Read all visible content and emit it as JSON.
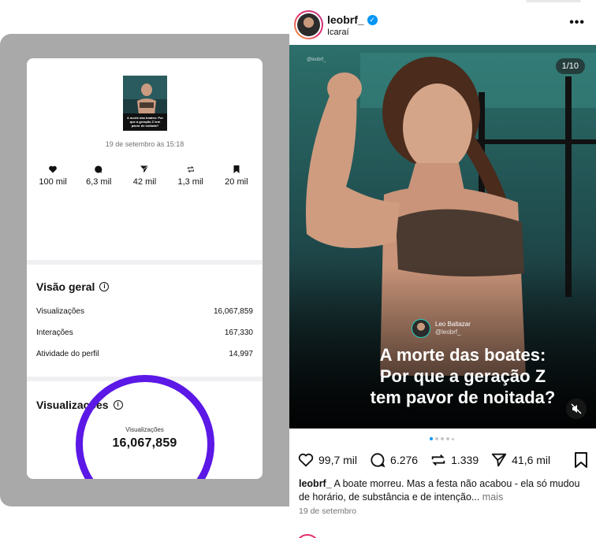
{
  "insights": {
    "post_date": "19 de setembro às 15:18",
    "thumbnail_text": "A morte das boates: Por que a geração Z tem pavor de noitada?",
    "stats": [
      {
        "icon": "heart-icon",
        "value": "100 mil"
      },
      {
        "icon": "comment-icon",
        "value": "6,3 mil"
      },
      {
        "icon": "send-icon",
        "value": "42 mil"
      },
      {
        "icon": "repost-icon",
        "value": "1,3 mil"
      },
      {
        "icon": "bookmark-icon",
        "value": "20 mil"
      }
    ],
    "overview": {
      "title": "Visão geral",
      "rows": [
        {
          "label": "Visualizações",
          "value": "16,067,859"
        },
        {
          "label": "Interações",
          "value": "167,330"
        },
        {
          "label": "Atividade do perfil",
          "value": "14,997"
        }
      ]
    },
    "views": {
      "title": "Visualizações",
      "donut_label": "Visualizações",
      "donut_value": "16,067,859",
      "accent": "#5b18e6"
    }
  },
  "post": {
    "username": "leobrf_",
    "location": "Icaraí",
    "counter": "1/10",
    "creator_name": "Leo Baltazar",
    "creator_handle": "@leobrf_",
    "headline": [
      "A morte das boates:",
      "Por que a geração Z",
      "tem pavor de noitada?"
    ],
    "actions": {
      "likes": "99,7 mil",
      "comments": "6.276",
      "reposts": "1.339",
      "shares": "41,6 mil"
    },
    "caption": {
      "user": "leobrf_",
      "text": " A boate morreu. Mas a festa não acabou - ela só mudou de horário, de substância e de intenção...",
      "more": " mais"
    },
    "date": "19 de setembro"
  }
}
